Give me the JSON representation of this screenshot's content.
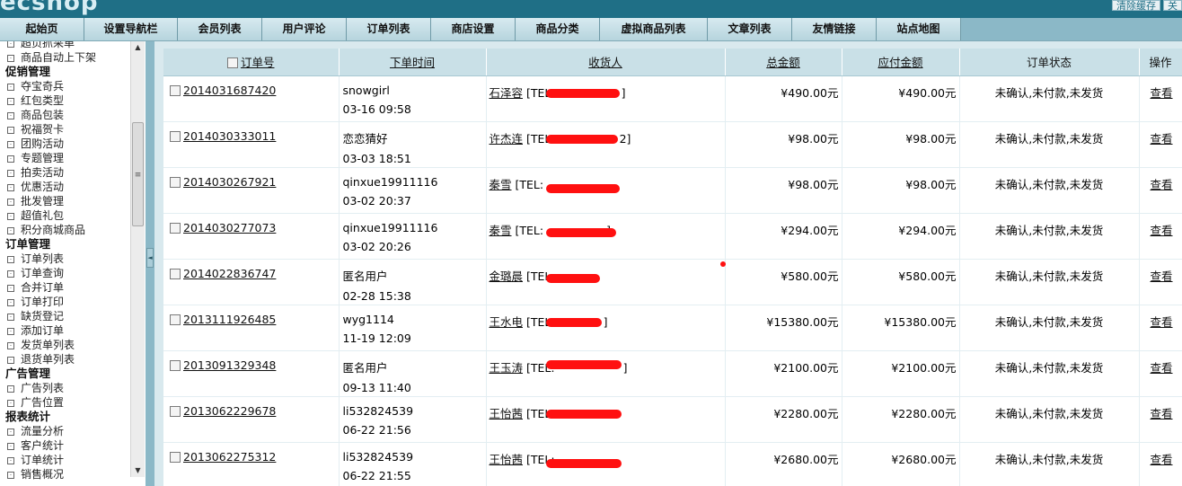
{
  "header": {
    "logo_text": "ecshop",
    "top_links": [
      "清除缓存",
      "关"
    ]
  },
  "nav": {
    "items": [
      "起始页",
      "设置导航栏",
      "会员列表",
      "用户评论",
      "订单列表",
      "商店设置",
      "商品分类",
      "虚拟商品列表",
      "文章列表",
      "友情链接",
      "站点地图"
    ]
  },
  "sidebar": {
    "menu": [
      {
        "type": "item",
        "label": "超页抓采单"
      },
      {
        "type": "item",
        "label": "商品自动上下架"
      },
      {
        "type": "group",
        "label": "促销管理"
      },
      {
        "type": "item",
        "label": "夺宝奇兵"
      },
      {
        "type": "item",
        "label": "红包类型"
      },
      {
        "type": "item",
        "label": "商品包装"
      },
      {
        "type": "item",
        "label": "祝福贺卡"
      },
      {
        "type": "item",
        "label": "团购活动"
      },
      {
        "type": "item",
        "label": "专题管理"
      },
      {
        "type": "item",
        "label": "拍卖活动"
      },
      {
        "type": "item",
        "label": "优惠活动"
      },
      {
        "type": "item",
        "label": "批发管理"
      },
      {
        "type": "item",
        "label": "超值礼包"
      },
      {
        "type": "item",
        "label": "积分商城商品"
      },
      {
        "type": "group",
        "label": "订单管理"
      },
      {
        "type": "item",
        "label": "订单列表"
      },
      {
        "type": "item",
        "label": "订单查询"
      },
      {
        "type": "item",
        "label": "合并订单"
      },
      {
        "type": "item",
        "label": "订单打印"
      },
      {
        "type": "item",
        "label": "缺货登记"
      },
      {
        "type": "item",
        "label": "添加订单"
      },
      {
        "type": "item",
        "label": "发货单列表"
      },
      {
        "type": "item",
        "label": "退货单列表"
      },
      {
        "type": "group",
        "label": "广告管理"
      },
      {
        "type": "item",
        "label": "广告列表"
      },
      {
        "type": "item",
        "label": "广告位置"
      },
      {
        "type": "group",
        "label": "报表统计"
      },
      {
        "type": "item",
        "label": "流量分析"
      },
      {
        "type": "item",
        "label": "客户统计"
      },
      {
        "type": "item",
        "label": "订单统计"
      },
      {
        "type": "item",
        "label": "销售概况"
      }
    ]
  },
  "table": {
    "columns": {
      "order_sn": "订单号",
      "order_time": "下单时间",
      "consignee": "收货人",
      "total": "总金额",
      "payable": "应付金额",
      "status": "订单状态",
      "op": "操作"
    },
    "rows": [
      {
        "sn": "2014031687420",
        "user": "snowgirl",
        "time": "03-16 09:58",
        "name": "石泽容",
        "tel": "[TEL:",
        "tel_end": "]",
        "total": "¥490.00元",
        "payable": "¥490.00元",
        "status": "未确认,未付款,未发货",
        "op": "查看"
      },
      {
        "sn": "2014030333011",
        "user": "恋恋猜好",
        "time": "03-03 18:51",
        "name": "许杰连",
        "tel": "[TEL:",
        "tel_end": "2]",
        "total": "¥98.00元",
        "payable": "¥98.00元",
        "status": "未确认,未付款,未发货",
        "op": "查看"
      },
      {
        "sn": "2014030267921",
        "user": "qinxue19911116",
        "time": "03-02 20:37",
        "name": "秦雪",
        "tel": "[TEL:",
        "tel_end": "",
        "total": "¥98.00元",
        "payable": "¥98.00元",
        "status": "未确认,未付款,未发货",
        "op": "查看"
      },
      {
        "sn": "2014030277073",
        "user": "qinxue19911116",
        "time": "03-02 20:26",
        "name": "秦雪",
        "tel": "[TEL:",
        "tel_end": "]",
        "total": "¥294.00元",
        "payable": "¥294.00元",
        "status": "未确认,未付款,未发货",
        "op": "查看"
      },
      {
        "sn": "2014022836747",
        "user": "匿名用户",
        "time": "02-28 15:38",
        "name": "金璐晨",
        "tel": "[TEL:",
        "tel_end": "",
        "total": "¥580.00元",
        "payable": "¥580.00元",
        "status": "未确认,未付款,未发货",
        "op": "查看"
      },
      {
        "sn": "2013111926485",
        "user": "wyg1114",
        "time": "11-19 12:09",
        "name": "王水电",
        "tel": "[TEL:",
        "tel_end": "]",
        "total": "¥15380.00元",
        "payable": "¥15380.00元",
        "status": "未确认,未付款,未发货",
        "op": "查看"
      },
      {
        "sn": "2013091329348",
        "user": "匿名用户",
        "time": "09-13 11:40",
        "name": "王玉涛",
        "tel": "[TEL:",
        "tel_end": "]",
        "total": "¥2100.00元",
        "payable": "¥2100.00元",
        "status": "未确认,未付款,未发货",
        "op": "查看"
      },
      {
        "sn": "2013062229678",
        "user": "li532824539",
        "time": "06-22 21:56",
        "name": "王怡茜",
        "tel": "[TEL:",
        "tel_end": "",
        "total": "¥2280.00元",
        "payable": "¥2280.00元",
        "status": "未确认,未付款,未发货",
        "op": "查看"
      },
      {
        "sn": "2013062275312",
        "user": "li532824539",
        "time": "06-22 21:55",
        "name": "王怡茜",
        "tel": "[TEL:",
        "tel_end": "",
        "total": "¥2680.00元",
        "payable": "¥2680.00元",
        "status": "未确认,未付款,未发货",
        "op": "查看"
      }
    ]
  },
  "colors": {
    "topbar": "#1f6f86",
    "nav": "#bcd9e2",
    "header_row": "#c9e0e7",
    "redaction": "#ff1010"
  }
}
